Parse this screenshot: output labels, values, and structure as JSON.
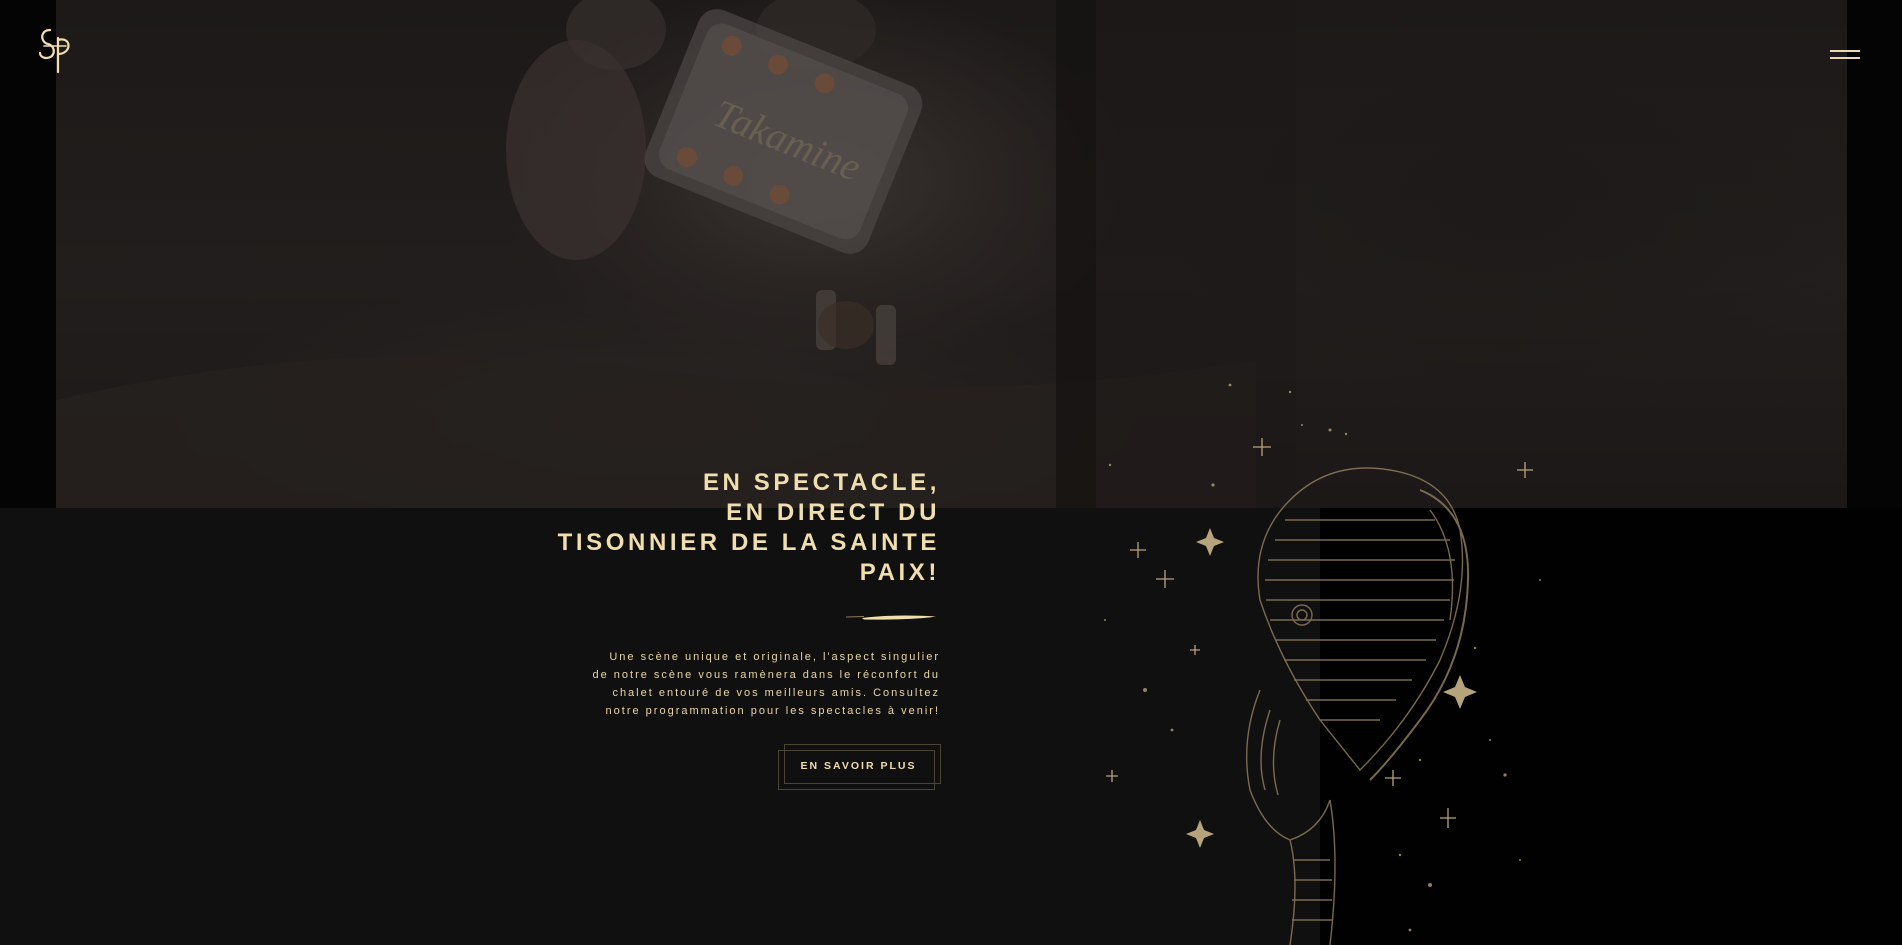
{
  "brand": {
    "logo_text": "SP",
    "accent_color": "#f0deaf"
  },
  "menu": {
    "icon": "hamburger-menu-icon"
  },
  "hero": {
    "headline_lines": [
      "EN SPECTACLE,",
      "EN DIRECT DU",
      "TISONNIER DE LA SAINTE",
      "PAIX!"
    ],
    "description_lines": [
      "Une scène unique et originale, l'aspect singulier",
      "de notre scène vous ramènera dans le réconfort du",
      "chalet entouré de vos meilleurs amis. Consultez",
      "notre programmation pour les spectacles à venir!"
    ],
    "cta_label": "EN SAVOIR PLUS",
    "photo": "guitar-headstock-photo",
    "illustration": "vintage-microphone-illustration"
  }
}
